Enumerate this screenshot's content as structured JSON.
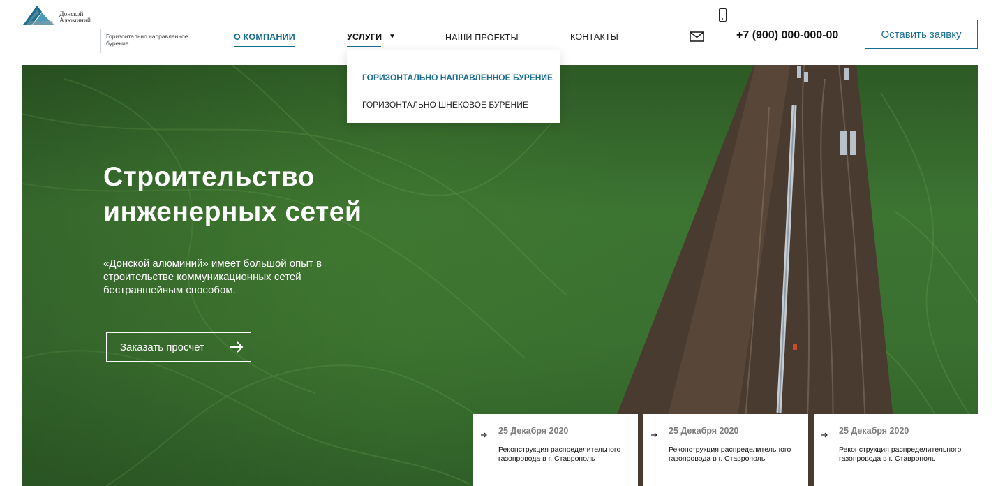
{
  "header": {
    "logo_text": [
      "Донской",
      "Алюминий"
    ],
    "tagline": "Горизонтально направленное бурение",
    "nav": [
      {
        "label": "О компании"
      },
      {
        "label": "Услуги"
      },
      {
        "label": "Наши проекты"
      },
      {
        "label": "Контакты"
      }
    ],
    "phone_number": "+7 (900) 000-000-00",
    "cta_label": "Оставить заявку",
    "caret": "▼"
  },
  "dropdown": {
    "items": [
      {
        "label": "Горизонтально направленное бурение",
        "active": true
      },
      {
        "label": "Горизонтально шнековое бурение",
        "active": false
      }
    ]
  },
  "hero": {
    "title": "Строительство инженерных сетей",
    "description": "«Донской алюминий» имеет большой опыт в строительстве коммуникационных сетей бестраншейным способом.",
    "button_label": "Заказать просчет"
  },
  "news": [
    {
      "date": "25 Декабря 2020",
      "title": "Реконструкция распределительного газопровода в г. Ставрополь"
    },
    {
      "date": "25 Декабря 2020",
      "title": "Реконструкция распределительного газопровода в г. Ставрополь"
    },
    {
      "date": "25 Декабря 2020",
      "title": "Реконструкция распределительного газопровода в г. Ставрополь"
    }
  ],
  "icons": {
    "logo": "mountain-logo-icon",
    "phone": "phone-icon",
    "mail": "mail-icon",
    "arrow": "arrow-right-icon"
  },
  "colors": {
    "accent": "#1a6d8f",
    "field_green": "#3c7432",
    "soil": "#4a3b30"
  }
}
